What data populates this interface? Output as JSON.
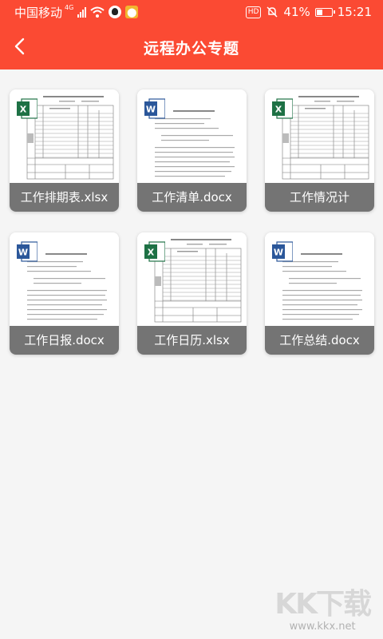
{
  "status_bar": {
    "carrier": "中国移动",
    "network": "4G",
    "battery_percent": "41%",
    "battery_level": 0.41,
    "time": "15:21",
    "hd_label": "HD",
    "icons": [
      "signal-icon",
      "wifi-icon",
      "qq-icon",
      "notification-icon",
      "hd-icon",
      "mute-icon",
      "battery-icon"
    ]
  },
  "header": {
    "title": "远程办公专题",
    "back_icon": "chevron-left-icon",
    "background": "#fb4a33"
  },
  "documents": [
    {
      "caption": "工作排期表.xlsx",
      "type": "xlsx"
    },
    {
      "caption": "工作清单.docx",
      "type": "docx"
    },
    {
      "caption": "工作情况计",
      "type": "xlsx"
    },
    {
      "caption": "工作日报.docx",
      "type": "docx"
    },
    {
      "caption": "工作日历.xlsx",
      "type": "xlsx"
    },
    {
      "caption": "工作总结.docx",
      "type": "docx"
    }
  ],
  "badge_text": {
    "xlsx": "X",
    "docx": "W"
  },
  "colors": {
    "xlsx": "#1e7145",
    "docx": "#2b579a"
  },
  "watermark": {
    "main": "KK下载",
    "sub": "www.kkx.net"
  }
}
